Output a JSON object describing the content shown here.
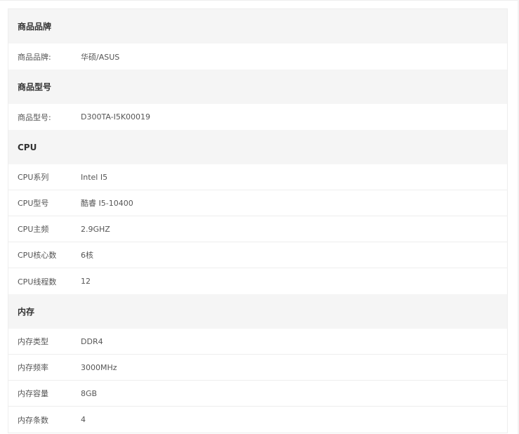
{
  "groups": [
    {
      "title": "商品品牌",
      "rows": [
        {
          "label": "商品品牌:",
          "value": "华硕/ASUS"
        }
      ]
    },
    {
      "title": "商品型号",
      "rows": [
        {
          "label": "商品型号:",
          "value": "D300TA-I5K00019"
        }
      ]
    },
    {
      "title": "CPU",
      "rows": [
        {
          "label": "CPU系列",
          "value": "Intel I5"
        },
        {
          "label": "CPU型号",
          "value": "酷睿 I5-10400"
        },
        {
          "label": "CPU主频",
          "value": "2.9GHZ"
        },
        {
          "label": "CPU核心数",
          "value": "6核"
        },
        {
          "label": "CPU线程数",
          "value": "12"
        }
      ]
    },
    {
      "title": "内存",
      "rows": [
        {
          "label": "内存类型",
          "value": "DDR4"
        },
        {
          "label": "内存频率",
          "value": "3000MHz"
        },
        {
          "label": "内存容量",
          "value": "8GB"
        },
        {
          "label": "内存条数",
          "value": "4"
        }
      ]
    }
  ]
}
